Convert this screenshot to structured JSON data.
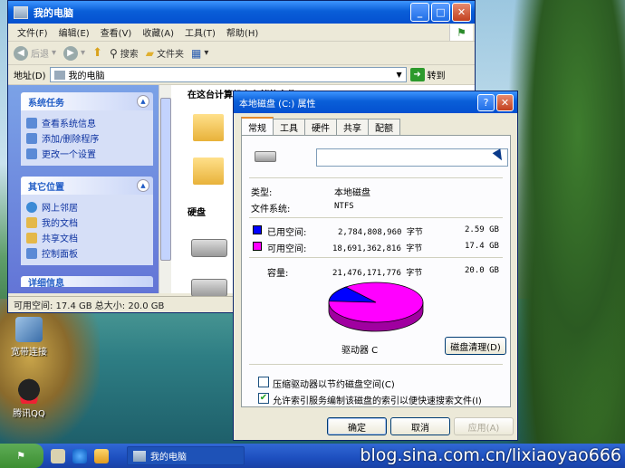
{
  "desktop": {
    "icons": [
      {
        "label": "宽带连接"
      },
      {
        "label": "腾讯QQ"
      }
    ],
    "watermark": "blog.sina.com.cn/lixiaoyao666"
  },
  "explorer": {
    "title": "我的电脑",
    "menu": [
      "文件(F)",
      "编辑(E)",
      "查看(V)",
      "收藏(A)",
      "工具(T)",
      "帮助(H)"
    ],
    "toolbar": {
      "back": "后退",
      "search": "搜索",
      "folders": "文件夹"
    },
    "address": {
      "label": "地址(D)",
      "value": "我的电脑",
      "go": "转到"
    },
    "tasks": {
      "system_title": "系统任务",
      "system_items": [
        "查看系统信息",
        "添加/删除程序",
        "更改一个设置"
      ],
      "places_title": "其它位置",
      "places_items": [
        "网上邻居",
        "我的文档",
        "共享文档",
        "控制面板"
      ],
      "details_title": "详细信息"
    },
    "content": {
      "heading": "在这台计算机上存储的文件",
      "drives_label": "硬盘"
    },
    "status": "可用空间: 17.4 GB 总大小: 20.0 GB"
  },
  "dialog": {
    "title": "本地磁盘 (C:) 属性",
    "tabs": [
      "常规",
      "工具",
      "硬件",
      "共享",
      "配额"
    ],
    "type_label": "类型:",
    "type_value": "本地磁盘",
    "fs_label": "文件系统:",
    "fs_value": "NTFS",
    "used_label": "已用空间:",
    "used_bytes": "2,784,808,960 字节",
    "used_gb": "2.59 GB",
    "free_label": "可用空间:",
    "free_bytes": "18,691,362,816 字节",
    "free_gb": "17.4 GB",
    "cap_label": "容量:",
    "cap_bytes": "21,476,171,776 字节",
    "cap_gb": "20.0 GB",
    "drive_label": "驱动器 C",
    "cleanup": "磁盘清理(D)",
    "compress": "压缩驱动器以节约磁盘空间(C)",
    "index": "允许索引服务编制该磁盘的索引以便快速搜索文件(I)",
    "ok": "确定",
    "cancel": "取消",
    "apply": "应用(A)",
    "colors": {
      "used": "#0000ff",
      "free": "#ff00ff"
    },
    "usage_fraction": 0.1297
  },
  "taskbar": {
    "start": "开始",
    "task": "我的电脑"
  }
}
